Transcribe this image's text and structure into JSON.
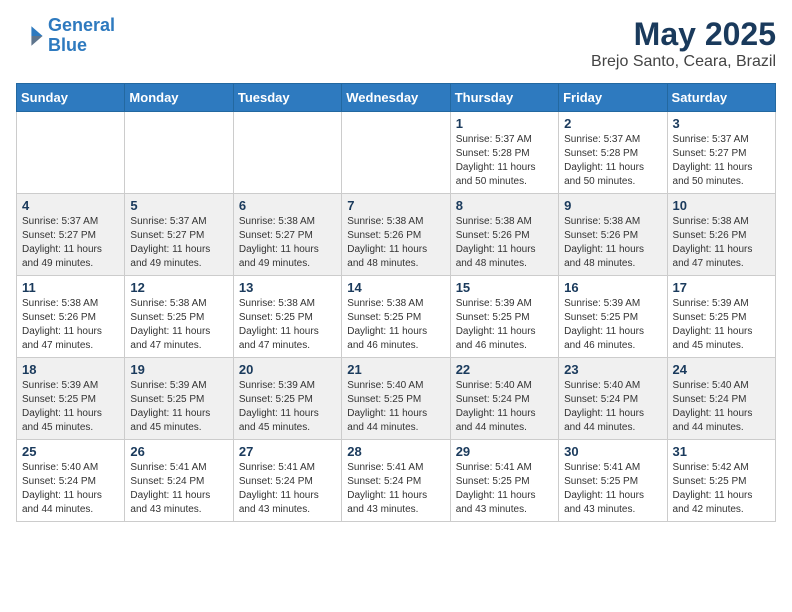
{
  "logo": {
    "line1": "General",
    "line2": "Blue"
  },
  "title": "May 2025",
  "location": "Brejo Santo, Ceara, Brazil",
  "days_of_week": [
    "Sunday",
    "Monday",
    "Tuesday",
    "Wednesday",
    "Thursday",
    "Friday",
    "Saturday"
  ],
  "weeks": [
    [
      {
        "day": "",
        "info": ""
      },
      {
        "day": "",
        "info": ""
      },
      {
        "day": "",
        "info": ""
      },
      {
        "day": "",
        "info": ""
      },
      {
        "day": "1",
        "info": "Sunrise: 5:37 AM\nSunset: 5:28 PM\nDaylight: 11 hours\nand 50 minutes."
      },
      {
        "day": "2",
        "info": "Sunrise: 5:37 AM\nSunset: 5:28 PM\nDaylight: 11 hours\nand 50 minutes."
      },
      {
        "day": "3",
        "info": "Sunrise: 5:37 AM\nSunset: 5:27 PM\nDaylight: 11 hours\nand 50 minutes."
      }
    ],
    [
      {
        "day": "4",
        "info": "Sunrise: 5:37 AM\nSunset: 5:27 PM\nDaylight: 11 hours\nand 49 minutes."
      },
      {
        "day": "5",
        "info": "Sunrise: 5:37 AM\nSunset: 5:27 PM\nDaylight: 11 hours\nand 49 minutes."
      },
      {
        "day": "6",
        "info": "Sunrise: 5:38 AM\nSunset: 5:27 PM\nDaylight: 11 hours\nand 49 minutes."
      },
      {
        "day": "7",
        "info": "Sunrise: 5:38 AM\nSunset: 5:26 PM\nDaylight: 11 hours\nand 48 minutes."
      },
      {
        "day": "8",
        "info": "Sunrise: 5:38 AM\nSunset: 5:26 PM\nDaylight: 11 hours\nand 48 minutes."
      },
      {
        "day": "9",
        "info": "Sunrise: 5:38 AM\nSunset: 5:26 PM\nDaylight: 11 hours\nand 48 minutes."
      },
      {
        "day": "10",
        "info": "Sunrise: 5:38 AM\nSunset: 5:26 PM\nDaylight: 11 hours\nand 47 minutes."
      }
    ],
    [
      {
        "day": "11",
        "info": "Sunrise: 5:38 AM\nSunset: 5:26 PM\nDaylight: 11 hours\nand 47 minutes."
      },
      {
        "day": "12",
        "info": "Sunrise: 5:38 AM\nSunset: 5:25 PM\nDaylight: 11 hours\nand 47 minutes."
      },
      {
        "day": "13",
        "info": "Sunrise: 5:38 AM\nSunset: 5:25 PM\nDaylight: 11 hours\nand 47 minutes."
      },
      {
        "day": "14",
        "info": "Sunrise: 5:38 AM\nSunset: 5:25 PM\nDaylight: 11 hours\nand 46 minutes."
      },
      {
        "day": "15",
        "info": "Sunrise: 5:39 AM\nSunset: 5:25 PM\nDaylight: 11 hours\nand 46 minutes."
      },
      {
        "day": "16",
        "info": "Sunrise: 5:39 AM\nSunset: 5:25 PM\nDaylight: 11 hours\nand 46 minutes."
      },
      {
        "day": "17",
        "info": "Sunrise: 5:39 AM\nSunset: 5:25 PM\nDaylight: 11 hours\nand 45 minutes."
      }
    ],
    [
      {
        "day": "18",
        "info": "Sunrise: 5:39 AM\nSunset: 5:25 PM\nDaylight: 11 hours\nand 45 minutes."
      },
      {
        "day": "19",
        "info": "Sunrise: 5:39 AM\nSunset: 5:25 PM\nDaylight: 11 hours\nand 45 minutes."
      },
      {
        "day": "20",
        "info": "Sunrise: 5:39 AM\nSunset: 5:25 PM\nDaylight: 11 hours\nand 45 minutes."
      },
      {
        "day": "21",
        "info": "Sunrise: 5:40 AM\nSunset: 5:25 PM\nDaylight: 11 hours\nand 44 minutes."
      },
      {
        "day": "22",
        "info": "Sunrise: 5:40 AM\nSunset: 5:24 PM\nDaylight: 11 hours\nand 44 minutes."
      },
      {
        "day": "23",
        "info": "Sunrise: 5:40 AM\nSunset: 5:24 PM\nDaylight: 11 hours\nand 44 minutes."
      },
      {
        "day": "24",
        "info": "Sunrise: 5:40 AM\nSunset: 5:24 PM\nDaylight: 11 hours\nand 44 minutes."
      }
    ],
    [
      {
        "day": "25",
        "info": "Sunrise: 5:40 AM\nSunset: 5:24 PM\nDaylight: 11 hours\nand 44 minutes."
      },
      {
        "day": "26",
        "info": "Sunrise: 5:41 AM\nSunset: 5:24 PM\nDaylight: 11 hours\nand 43 minutes."
      },
      {
        "day": "27",
        "info": "Sunrise: 5:41 AM\nSunset: 5:24 PM\nDaylight: 11 hours\nand 43 minutes."
      },
      {
        "day": "28",
        "info": "Sunrise: 5:41 AM\nSunset: 5:24 PM\nDaylight: 11 hours\nand 43 minutes."
      },
      {
        "day": "29",
        "info": "Sunrise: 5:41 AM\nSunset: 5:25 PM\nDaylight: 11 hours\nand 43 minutes."
      },
      {
        "day": "30",
        "info": "Sunrise: 5:41 AM\nSunset: 5:25 PM\nDaylight: 11 hours\nand 43 minutes."
      },
      {
        "day": "31",
        "info": "Sunrise: 5:42 AM\nSunset: 5:25 PM\nDaylight: 11 hours\nand 42 minutes."
      }
    ]
  ]
}
